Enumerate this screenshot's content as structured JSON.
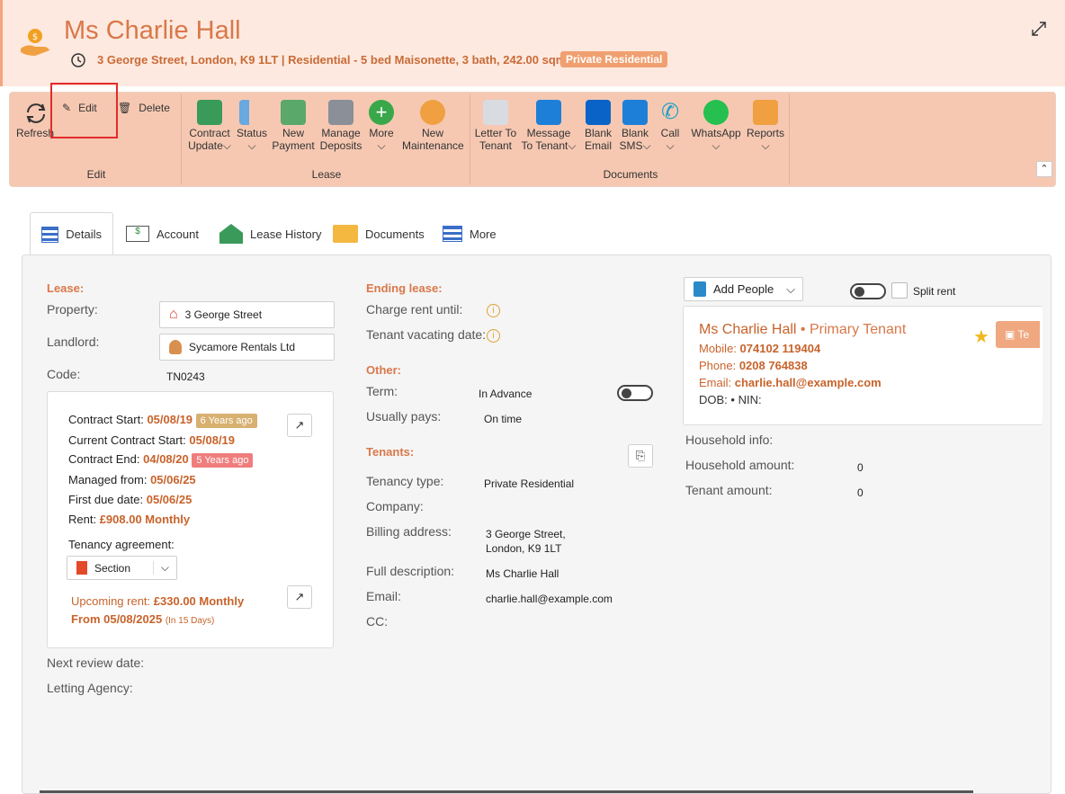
{
  "header": {
    "title": "Ms Charlie Hall",
    "subtitle": "3 George Street, London, K9 1LT | Residential - 5 bed Maisonette, 3 bath, 242.00 sqm |",
    "badge": "Private Residential"
  },
  "ribbon": {
    "refresh": "Refresh",
    "edit": "Edit",
    "delete": "Delete",
    "group_edit": "Edit",
    "contract_update": [
      "Contract",
      "Update"
    ],
    "status": "Status",
    "new_payment": [
      "New",
      "Payment"
    ],
    "manage_deposits": [
      "Manage",
      "Deposits"
    ],
    "more": "More",
    "new_maintenance": [
      "New",
      "Maintenance"
    ],
    "group_lease": "Lease",
    "letter_to_tenant": [
      "Letter To",
      "Tenant"
    ],
    "message_to_tenant": [
      "Message",
      "To Tenant"
    ],
    "blank_email": [
      "Blank",
      "Email"
    ],
    "blank_sms": [
      "Blank",
      "SMS"
    ],
    "call": "Call",
    "whatsapp": "WhatsApp",
    "reports": "Reports",
    "group_documents": "Documents"
  },
  "tabs": [
    "Details",
    "Account",
    "Lease History",
    "Documents",
    "More"
  ],
  "lease": {
    "section": "Lease:",
    "property_label": "Property:",
    "property_value": "3 George Street",
    "landlord_label": "Landlord:",
    "landlord_value": "Sycamore Rentals Ltd",
    "code_label": "Code:",
    "code_value": "TN0243"
  },
  "contract": {
    "start_label": "Contract Start:",
    "start_value": "05/08/19",
    "start_chip": "6 Years ago",
    "current_label": "Current Contract Start:",
    "current_value": "05/08/19",
    "end_label": "Contract End:",
    "end_value": "04/08/20",
    "end_chip": "5 Years ago",
    "managed_label": "Managed from:",
    "managed_value": "05/06/25",
    "first_due_label": "First due date:",
    "first_due_value": "05/06/25",
    "rent_label": "Rent:",
    "rent_value": "£908.00 Monthly",
    "agreement_label": "Tenancy agreement:",
    "agreement_value": "Section",
    "upcoming_label": "Upcoming rent:",
    "upcoming_value": "£330.00 Monthly",
    "from_value": "From 05/08/2025",
    "from_note": "(In 15 Days)"
  },
  "bottom": {
    "review_label": "Next review date:",
    "agency_label": "Letting Agency:"
  },
  "ending": {
    "section": "Ending lease:",
    "charge_label": "Charge rent until:",
    "vacating_label": "Tenant vacating date:"
  },
  "other": {
    "section": "Other:",
    "term_label": "Term:",
    "term_value": "In Advance",
    "pays_label": "Usually pays:",
    "pays_value": "On time"
  },
  "tenants": {
    "section": "Tenants:",
    "type_label": "Tenancy type:",
    "type_value": "Private Residential",
    "company_label": "Company:",
    "billing_label": "Billing address:",
    "billing_line1": "3 George Street,",
    "billing_line2": "London, K9 1LT",
    "desc_label": "Full description:",
    "desc_value": "Ms Charlie Hall",
    "email_label": "Email:",
    "email_value": "charlie.hall@example.com",
    "cc_label": "CC:"
  },
  "people": {
    "add_people": "Add People",
    "split_rent": "Split rent",
    "name": "Ms Charlie Hall",
    "role": "• Primary Tenant",
    "mobile_label": "Mobile:",
    "mobile_value": "074102 119404",
    "phone_label": "Phone:",
    "phone_value": "0208 764838",
    "email_label": "Email:",
    "email_value": "charlie.hall@example.com",
    "dob_label": "DOB:",
    "nin_label": "• NIN:",
    "tag_text": "Te"
  },
  "household": {
    "info_label": "Household info:",
    "amount_label": "Household amount:",
    "amount_value": "0",
    "tenant_label": "Tenant amount:",
    "tenant_value": "0"
  },
  "colors": {
    "accent": "#d9784a",
    "header_bg": "#fde9df",
    "ribbon_bg": "#f6c8b2",
    "chip_gold": "#d8b070",
    "chip_red": "#f07d7d"
  }
}
